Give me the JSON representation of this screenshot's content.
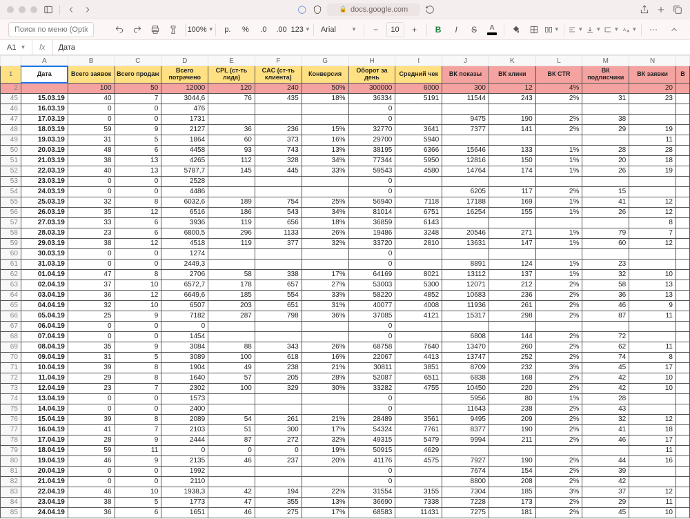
{
  "browser": {
    "domain": "docs.google.com"
  },
  "toolbar": {
    "search_placeholder": "Поиск по меню (Option+/)",
    "zoom": "100%",
    "currency": "р.",
    "percent": "%",
    "dec_minus": ".0",
    "dec_plus": ".00",
    "numfmt": "123",
    "font": "Arial",
    "size": "10",
    "text_color_letter": "A"
  },
  "formula": {
    "cell": "A1",
    "fx": "fx",
    "value": "Дата"
  },
  "cols": [
    "A",
    "B",
    "C",
    "D",
    "E",
    "F",
    "G",
    "H",
    "I",
    "J",
    "K",
    "L",
    "M",
    "N"
  ],
  "headers": {
    "row": 1,
    "A": "Дата",
    "B": "Всего заявок",
    "C": "Всего продаж",
    "D": "Всего потрачено",
    "E": "CPL (ст-ть лида)",
    "F": "CAC (ст-ть клиента)",
    "G": "Конверсия",
    "H": "Оборот за день",
    "I": "Средний чек",
    "J": "ВК показы",
    "K": "ВК клики",
    "L": "ВК CTR",
    "M": "ВК подписчики",
    "N": "ВК заявки"
  },
  "targets": {
    "row": 2,
    "B": "100",
    "C": "50",
    "D": "12000",
    "E": "120",
    "F": "240",
    "G": "50%",
    "H": "300000",
    "I": "6000",
    "J": "300",
    "K": "12",
    "L": "4%",
    "M": "",
    "N": "20"
  },
  "rows": [
    {
      "r": 45,
      "A": "15.03.19",
      "B": "40",
      "C": "7",
      "D": "3044,6",
      "E": "76",
      "F": "435",
      "G": "18%",
      "H": "36334",
      "I": "5191",
      "J": "11544",
      "K": "243",
      "L": "2%",
      "M": "31",
      "N": "23"
    },
    {
      "r": 46,
      "A": "16.03.19",
      "B": "0",
      "C": "0",
      "D": "476",
      "E": "",
      "F": "",
      "G": "",
      "H": "0",
      "I": "",
      "J": "",
      "K": "",
      "L": "",
      "M": "",
      "N": ""
    },
    {
      "r": 47,
      "A": "17.03.19",
      "B": "0",
      "C": "0",
      "D": "1731",
      "E": "",
      "F": "",
      "G": "",
      "H": "0",
      "I": "",
      "J": "9475",
      "K": "190",
      "L": "2%",
      "M": "38",
      "N": ""
    },
    {
      "r": 48,
      "A": "18.03.19",
      "B": "59",
      "C": "9",
      "D": "2127",
      "E": "36",
      "F": "236",
      "G": "15%",
      "H": "32770",
      "I": "3641",
      "J": "7377",
      "K": "141",
      "L": "2%",
      "M": "29",
      "N": "19"
    },
    {
      "r": 49,
      "A": "19.03.19",
      "B": "31",
      "C": "5",
      "D": "1864",
      "E": "60",
      "F": "373",
      "G": "16%",
      "H": "29700",
      "I": "5940",
      "J": "",
      "K": "",
      "L": "",
      "M": "",
      "N": "11"
    },
    {
      "r": 50,
      "A": "20.03.19",
      "B": "48",
      "C": "6",
      "D": "4458",
      "E": "93",
      "F": "743",
      "G": "13%",
      "H": "38195",
      "I": "6366",
      "J": "15646",
      "K": "133",
      "L": "1%",
      "M": "28",
      "N": "28"
    },
    {
      "r": 51,
      "A": "21.03.19",
      "B": "38",
      "C": "13",
      "D": "4265",
      "E": "112",
      "F": "328",
      "G": "34%",
      "H": "77344",
      "I": "5950",
      "J": "12816",
      "K": "150",
      "L": "1%",
      "M": "20",
      "N": "18"
    },
    {
      "r": 52,
      "A": "22.03.19",
      "B": "40",
      "C": "13",
      "D": "5787,7",
      "E": "145",
      "F": "445",
      "G": "33%",
      "H": "59543",
      "I": "4580",
      "J": "14764",
      "K": "174",
      "L": "1%",
      "M": "26",
      "N": "19"
    },
    {
      "r": 53,
      "A": "23.03.19",
      "B": "0",
      "C": "0",
      "D": "2528",
      "E": "",
      "F": "",
      "G": "",
      "H": "0",
      "I": "",
      "J": "",
      "K": "",
      "L": "",
      "M": "",
      "N": ""
    },
    {
      "r": 54,
      "A": "24.03.19",
      "B": "0",
      "C": "0",
      "D": "4486",
      "E": "",
      "F": "",
      "G": "",
      "H": "0",
      "I": "",
      "J": "6205",
      "K": "117",
      "L": "2%",
      "M": "15",
      "N": ""
    },
    {
      "r": 55,
      "A": "25.03.19",
      "B": "32",
      "C": "8",
      "D": "6032,6",
      "E": "189",
      "F": "754",
      "G": "25%",
      "H": "56940",
      "I": "7118",
      "J": "17188",
      "K": "169",
      "L": "1%",
      "M": "41",
      "N": "12"
    },
    {
      "r": 56,
      "A": "26.03.19",
      "B": "35",
      "C": "12",
      "D": "6516",
      "E": "186",
      "F": "543",
      "G": "34%",
      "H": "81014",
      "I": "6751",
      "J": "16254",
      "K": "155",
      "L": "1%",
      "M": "26",
      "N": "12"
    },
    {
      "r": 57,
      "A": "27.03.19",
      "B": "33",
      "C": "6",
      "D": "3936",
      "E": "119",
      "F": "656",
      "G": "18%",
      "H": "36859",
      "I": "6143",
      "J": "",
      "K": "",
      "L": "",
      "M": "",
      "N": "8"
    },
    {
      "r": 58,
      "A": "28.03.19",
      "B": "23",
      "C": "6",
      "D": "6800,5",
      "E": "296",
      "F": "1133",
      "G": "26%",
      "H": "19486",
      "I": "3248",
      "J": "20546",
      "K": "271",
      "L": "1%",
      "M": "79",
      "N": "7"
    },
    {
      "r": 59,
      "A": "29.03.19",
      "B": "38",
      "C": "12",
      "D": "4518",
      "E": "119",
      "F": "377",
      "G": "32%",
      "H": "33720",
      "I": "2810",
      "J": "13631",
      "K": "147",
      "L": "1%",
      "M": "60",
      "N": "12"
    },
    {
      "r": 60,
      "A": "30.03.19",
      "B": "0",
      "C": "0",
      "D": "1274",
      "E": "",
      "F": "",
      "G": "",
      "H": "0",
      "I": "",
      "J": "",
      "K": "",
      "L": "",
      "M": "",
      "N": ""
    },
    {
      "r": 61,
      "A": "31.03.19",
      "B": "0",
      "C": "0",
      "D": "2449,3",
      "E": "",
      "F": "",
      "G": "",
      "H": "0",
      "I": "",
      "J": "8891",
      "K": "124",
      "L": "1%",
      "M": "23",
      "N": ""
    },
    {
      "r": 62,
      "A": "01.04.19",
      "B": "47",
      "C": "8",
      "D": "2706",
      "E": "58",
      "F": "338",
      "G": "17%",
      "H": "64169",
      "I": "8021",
      "J": "13112",
      "K": "137",
      "L": "1%",
      "M": "32",
      "N": "10"
    },
    {
      "r": 63,
      "A": "02.04.19",
      "B": "37",
      "C": "10",
      "D": "6572,7",
      "E": "178",
      "F": "657",
      "G": "27%",
      "H": "53003",
      "I": "5300",
      "J": "12071",
      "K": "212",
      "L": "2%",
      "M": "58",
      "N": "13"
    },
    {
      "r": 64,
      "A": "03.04.19",
      "B": "36",
      "C": "12",
      "D": "6649,6",
      "E": "185",
      "F": "554",
      "G": "33%",
      "H": "58220",
      "I": "4852",
      "J": "10683",
      "K": "236",
      "L": "2%",
      "M": "36",
      "N": "13"
    },
    {
      "r": 65,
      "A": "04.04.19",
      "B": "32",
      "C": "10",
      "D": "6507",
      "E": "203",
      "F": "651",
      "G": "31%",
      "H": "40077",
      "I": "4008",
      "J": "11936",
      "K": "261",
      "L": "2%",
      "M": "46",
      "N": "9"
    },
    {
      "r": 66,
      "A": "05.04.19",
      "B": "25",
      "C": "9",
      "D": "7182",
      "E": "287",
      "F": "798",
      "G": "36%",
      "H": "37085",
      "I": "4121",
      "J": "15317",
      "K": "298",
      "L": "2%",
      "M": "87",
      "N": "11"
    },
    {
      "r": 67,
      "A": "06.04.19",
      "B": "0",
      "C": "0",
      "D": "0",
      "E": "",
      "F": "",
      "G": "",
      "H": "0",
      "I": "",
      "J": "",
      "K": "",
      "L": "",
      "M": "",
      "N": ""
    },
    {
      "r": 68,
      "A": "07.04.19",
      "B": "0",
      "C": "0",
      "D": "1454",
      "E": "",
      "F": "",
      "G": "",
      "H": "0",
      "I": "",
      "J": "6808",
      "K": "144",
      "L": "2%",
      "M": "72",
      "N": ""
    },
    {
      "r": 69,
      "A": "08.04.19",
      "B": "35",
      "C": "9",
      "D": "3084",
      "E": "88",
      "F": "343",
      "G": "26%",
      "H": "68758",
      "I": "7640",
      "J": "13470",
      "K": "260",
      "L": "2%",
      "M": "62",
      "N": "11"
    },
    {
      "r": 70,
      "A": "09.04.19",
      "B": "31",
      "C": "5",
      "D": "3089",
      "E": "100",
      "F": "618",
      "G": "16%",
      "H": "22067",
      "I": "4413",
      "J": "13747",
      "K": "252",
      "L": "2%",
      "M": "74",
      "N": "8"
    },
    {
      "r": 71,
      "A": "10.04.19",
      "B": "39",
      "C": "8",
      "D": "1904",
      "E": "49",
      "F": "238",
      "G": "21%",
      "H": "30811",
      "I": "3851",
      "J": "8709",
      "K": "232",
      "L": "3%",
      "M": "45",
      "N": "17"
    },
    {
      "r": 72,
      "A": "11.04.19",
      "B": "29",
      "C": "8",
      "D": "1640",
      "E": "57",
      "F": "205",
      "G": "28%",
      "H": "52087",
      "I": "6511",
      "J": "6838",
      "K": "168",
      "L": "2%",
      "M": "42",
      "N": "10"
    },
    {
      "r": 73,
      "A": "12.04.19",
      "B": "23",
      "C": "7",
      "D": "2302",
      "E": "100",
      "F": "329",
      "G": "30%",
      "H": "33282",
      "I": "4755",
      "J": "10450",
      "K": "220",
      "L": "2%",
      "M": "42",
      "N": "10"
    },
    {
      "r": 74,
      "A": "13.04.19",
      "B": "0",
      "C": "0",
      "D": "1573",
      "E": "",
      "F": "",
      "G": "",
      "H": "0",
      "I": "",
      "J": "5956",
      "K": "80",
      "L": "1%",
      "M": "28",
      "N": ""
    },
    {
      "r": 75,
      "A": "14.04.19",
      "B": "0",
      "C": "0",
      "D": "2400",
      "E": "",
      "F": "",
      "G": "",
      "H": "0",
      "I": "",
      "J": "11643",
      "K": "238",
      "L": "2%",
      "M": "43",
      "N": ""
    },
    {
      "r": 76,
      "A": "15.04.19",
      "B": "39",
      "C": "8",
      "D": "2089",
      "E": "54",
      "F": "261",
      "G": "21%",
      "H": "28489",
      "I": "3561",
      "J": "9495",
      "K": "209",
      "L": "2%",
      "M": "32",
      "N": "12"
    },
    {
      "r": 77,
      "A": "16.04.19",
      "B": "41",
      "C": "7",
      "D": "2103",
      "E": "51",
      "F": "300",
      "G": "17%",
      "H": "54324",
      "I": "7761",
      "J": "8377",
      "K": "190",
      "L": "2%",
      "M": "41",
      "N": "18"
    },
    {
      "r": 78,
      "A": "17.04.19",
      "B": "28",
      "C": "9",
      "D": "2444",
      "E": "87",
      "F": "272",
      "G": "32%",
      "H": "49315",
      "I": "5479",
      "J": "9994",
      "K": "211",
      "L": "2%",
      "M": "46",
      "N": "17"
    },
    {
      "r": 79,
      "A": "18.04.19",
      "B": "59",
      "C": "11",
      "D": "0",
      "E": "0",
      "F": "0",
      "G": "19%",
      "H": "50915",
      "I": "4629",
      "J": "",
      "K": "",
      "L": "",
      "M": "",
      "N": "11"
    },
    {
      "r": 80,
      "A": "19.04.19",
      "B": "46",
      "C": "9",
      "D": "2135",
      "E": "46",
      "F": "237",
      "G": "20%",
      "H": "41176",
      "I": "4575",
      "J": "7927",
      "K": "190",
      "L": "2%",
      "M": "44",
      "N": "16"
    },
    {
      "r": 81,
      "A": "20.04.19",
      "B": "0",
      "C": "0",
      "D": "1992",
      "E": "",
      "F": "",
      "G": "",
      "H": "0",
      "I": "",
      "J": "7674",
      "K": "154",
      "L": "2%",
      "M": "39",
      "N": ""
    },
    {
      "r": 82,
      "A": "21.04.19",
      "B": "0",
      "C": "0",
      "D": "2110",
      "E": "",
      "F": "",
      "G": "",
      "H": "0",
      "I": "",
      "J": "8800",
      "K": "208",
      "L": "2%",
      "M": "42",
      "N": ""
    },
    {
      "r": 83,
      "A": "22.04.19",
      "B": "46",
      "C": "10",
      "D": "1938,3",
      "E": "42",
      "F": "194",
      "G": "22%",
      "H": "31554",
      "I": "3155",
      "J": "7304",
      "K": "185",
      "L": "3%",
      "M": "37",
      "N": "12"
    },
    {
      "r": 84,
      "A": "23.04.19",
      "B": "38",
      "C": "5",
      "D": "1773",
      "E": "47",
      "F": "355",
      "G": "13%",
      "H": "36690",
      "I": "7338",
      "J": "7228",
      "K": "173",
      "L": "2%",
      "M": "29",
      "N": "11"
    },
    {
      "r": 85,
      "A": "24.04.19",
      "B": "36",
      "C": "6",
      "D": "1651",
      "E": "46",
      "F": "275",
      "G": "17%",
      "H": "68583",
      "I": "11431",
      "J": "7275",
      "K": "181",
      "L": "2%",
      "M": "45",
      "N": "10"
    }
  ]
}
